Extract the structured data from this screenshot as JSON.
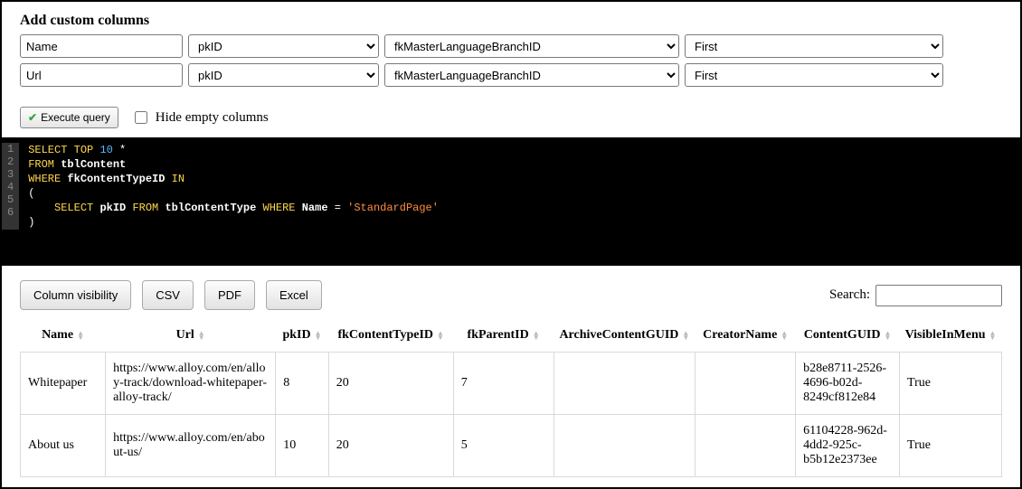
{
  "heading": "Add custom columns",
  "custom_rows": [
    {
      "name": "Name",
      "sel1": "pkID",
      "sel2": "fkMasterLanguageBranchID",
      "sel3": "First"
    },
    {
      "name": "Url",
      "sel1": "pkID",
      "sel2": "fkMasterLanguageBranchID",
      "sel3": "First"
    }
  ],
  "exec_label": "Execute query",
  "hide_label": "Hide empty columns",
  "sql_lines": [
    [
      {
        "t": "SELECT",
        "c": "kw"
      },
      {
        "t": " "
      },
      {
        "t": "TOP",
        "c": "kw"
      },
      {
        "t": " "
      },
      {
        "t": "10",
        "c": "num"
      },
      {
        "t": " *"
      }
    ],
    [
      {
        "t": "FROM",
        "c": "kw"
      },
      {
        "t": " "
      },
      {
        "t": "tblContent",
        "c": "tbl"
      }
    ],
    [
      {
        "t": "WHERE",
        "c": "kw"
      },
      {
        "t": " "
      },
      {
        "t": "fkContentTypeID",
        "c": "col"
      },
      {
        "t": " "
      },
      {
        "t": "IN",
        "c": "kw"
      }
    ],
    [
      {
        "t": "("
      }
    ],
    [
      {
        "t": "    "
      },
      {
        "t": "SELECT",
        "c": "kw"
      },
      {
        "t": " "
      },
      {
        "t": "pkID",
        "c": "col"
      },
      {
        "t": " "
      },
      {
        "t": "FROM",
        "c": "kw"
      },
      {
        "t": " "
      },
      {
        "t": "tblContentType",
        "c": "tbl"
      },
      {
        "t": " "
      },
      {
        "t": "WHERE",
        "c": "kw"
      },
      {
        "t": " "
      },
      {
        "t": "Name",
        "c": "col"
      },
      {
        "t": " = "
      },
      {
        "t": "'StandardPage'",
        "c": "str"
      }
    ],
    [
      {
        "t": ")"
      }
    ]
  ],
  "buttons": {
    "colvis": "Column visibility",
    "csv": "CSV",
    "pdf": "PDF",
    "excel": "Excel"
  },
  "search_label": "Search:",
  "columns": [
    "Name",
    "Url",
    "pkID",
    "fkContentTypeID",
    "fkParentID",
    "ArchiveContentGUID",
    "CreatorName",
    "ContentGUID",
    "VisibleInMenu"
  ],
  "rows": [
    {
      "Name": "Whitepaper",
      "Url": "https://www.alloy.com/en/alloy-track/download-whitepaper-alloy-track/",
      "pkID": "8",
      "fkContentTypeID": "20",
      "fkParentID": "7",
      "ArchiveContentGUID": "",
      "CreatorName": "",
      "ContentGUID": "b28e8711-2526-4696-b02d-8249cf812e84",
      "VisibleInMenu": "True"
    },
    {
      "Name": "About us",
      "Url": "https://www.alloy.com/en/about-us/",
      "pkID": "10",
      "fkContentTypeID": "20",
      "fkParentID": "5",
      "ArchiveContentGUID": "",
      "CreatorName": "",
      "ContentGUID": "61104228-962d-4dd2-925c-b5b12e2373ee",
      "VisibleInMenu": "True"
    }
  ]
}
